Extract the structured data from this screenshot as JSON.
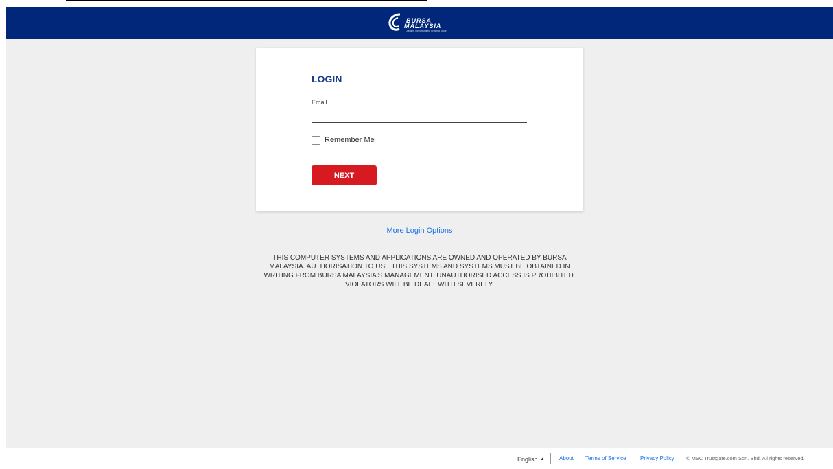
{
  "header": {
    "logo": {
      "line1": "BURSA",
      "line2": "MALAYSIA",
      "tagline": "Creating Opportunities, Growing Value"
    }
  },
  "login": {
    "title": "LOGIN",
    "email_label": "Email",
    "email_value": "",
    "email_placeholder": "",
    "remember_label": "Remember Me",
    "remember_checked": false,
    "next_label": "NEXT"
  },
  "more_login_options": "More Login Options",
  "disclaimer": "THIS COMPUTER SYSTEMS AND APPLICATIONS ARE OWNED AND OPERATED BY BURSA MALAYSIA. AUTHORISATION TO USE THIS SYSTEMS AND SYSTEMS MUST BE OBTAINED IN WRITING FROM BURSA MALAYSIA'S MANAGEMENT. UNAUTHORISED ACCESS IS PROHIBITED. VIOLATORS WILL BE DEALT WITH SEVERELY.",
  "footer": {
    "language": "English",
    "links": {
      "about": "About",
      "terms": "Terms of Service",
      "privacy": "Privacy Policy"
    },
    "copyright": "© MSC Trustgate.com Sdn. Bhd.  All rights reserved."
  },
  "colors": {
    "header_bg": "#00277a",
    "page_bg": "#efefef",
    "primary_button": "#d71920",
    "link": "#1a73e8",
    "title": "#173a8a"
  }
}
